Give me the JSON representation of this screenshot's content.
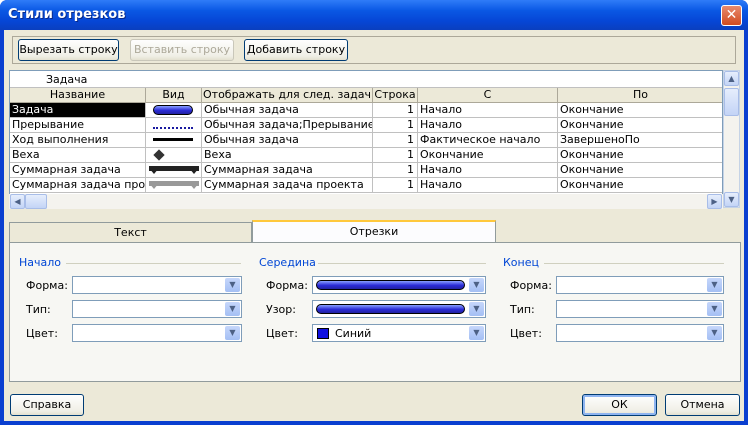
{
  "window": {
    "title": "Стили отрезков"
  },
  "toolbar": {
    "cut_label": "Вырезать строку",
    "paste_label": "Вставить строку",
    "add_label": "Добавить строку"
  },
  "grid": {
    "entry_value": "Задача",
    "headers": [
      "Название",
      "Вид",
      "Отображать для след. задач",
      "Строка",
      "С",
      "По"
    ],
    "rows": [
      {
        "name": "Задача",
        "appearance": "blue-rounded-bar",
        "show_for": "Обычная задача",
        "row": "1",
        "from": "Начало",
        "to": "Окончание"
      },
      {
        "name": "Прерывание",
        "appearance": "dotted-line",
        "show_for": "Обычная задача;Прерывание",
        "row": "1",
        "from": "Начало",
        "to": "Окончание"
      },
      {
        "name": "Ход выполнения",
        "appearance": "thin-black-line",
        "show_for": "Обычная задача",
        "row": "1",
        "from": "Фактическое начало",
        "to": "ЗавершеноПо"
      },
      {
        "name": "Веха",
        "appearance": "diamond",
        "show_for": "Веха",
        "row": "1",
        "from": "Окончание",
        "to": "Окончание"
      },
      {
        "name": "Суммарная задача",
        "appearance": "black-summary-bar",
        "show_for": "Суммарная задача",
        "row": "1",
        "from": "Начало",
        "to": "Окончание"
      },
      {
        "name": "Суммарная задача проек",
        "appearance": "gray-summary-bar",
        "show_for": "Суммарная задача проекта",
        "row": "1",
        "from": "Начало",
        "to": "Окончание"
      }
    ]
  },
  "tabs": [
    {
      "label": "Текст"
    },
    {
      "label": "Отрезки"
    }
  ],
  "start_group": {
    "title": "Начало",
    "shape_label": "Форма:",
    "type_label": "Тип:",
    "color_label": "Цвет:"
  },
  "middle_group": {
    "title": "Середина",
    "shape_label": "Форма:",
    "pattern_label": "Узор:",
    "color_label": "Цвет:",
    "color_value": "Синий"
  },
  "end_group": {
    "title": "Конец",
    "shape_label": "Форма:",
    "type_label": "Тип:",
    "color_label": "Цвет:"
  },
  "footer": {
    "help_label": "Справка",
    "ok_label": "ОК",
    "cancel_label": "Отмена"
  },
  "colors": {
    "title_bar": "#0a58e4",
    "dialog_bg": "#ece9d8",
    "middle_bar": "#2a2ad6",
    "group_title": "#0046d5"
  }
}
